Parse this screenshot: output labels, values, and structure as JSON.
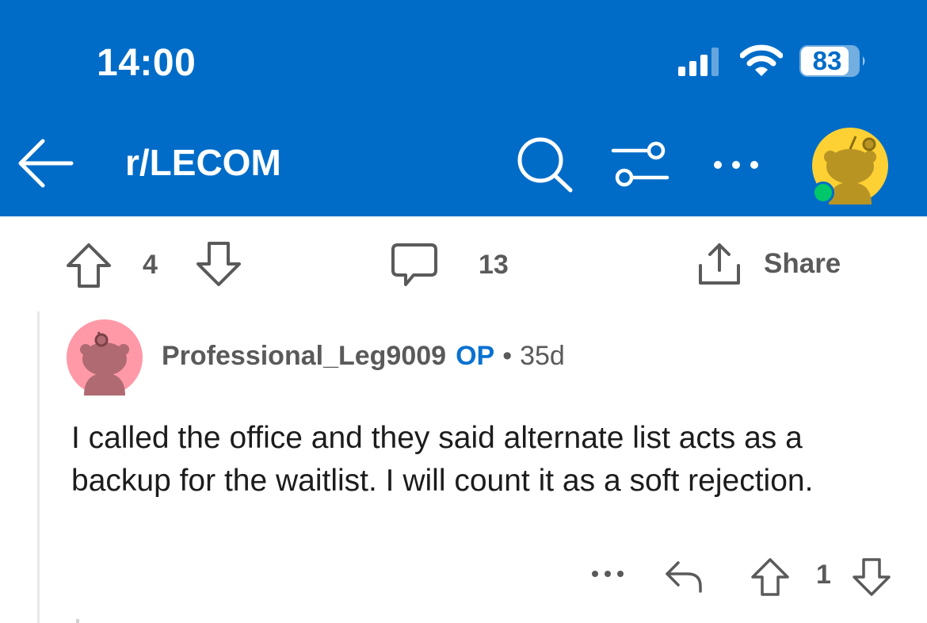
{
  "status_bar": {
    "time": "14:00",
    "battery": "83"
  },
  "header": {
    "subreddit": "r/LECOM"
  },
  "post_actions": {
    "score": "4",
    "comments": "13",
    "share_label": "Share"
  },
  "comment": {
    "author": "Professional_Leg9009",
    "op_badge": "OP",
    "separator": "•",
    "age": "35d",
    "body": "I called the office and they said alternate list acts as a backup for the waitlist. I will count it as a soft rejection.",
    "score": "1"
  },
  "colors": {
    "header_bg": "#006cc8",
    "op_blue": "#0a72d1",
    "online_green": "#00c86a",
    "avatar_yellow": "#fdd133",
    "avatar_pink": "#ff99a8"
  },
  "icons": [
    "back-arrow-icon",
    "search-icon",
    "filter-icon",
    "more-icon",
    "upvote-icon",
    "downvote-icon",
    "comment-icon",
    "share-icon",
    "reply-icon"
  ]
}
